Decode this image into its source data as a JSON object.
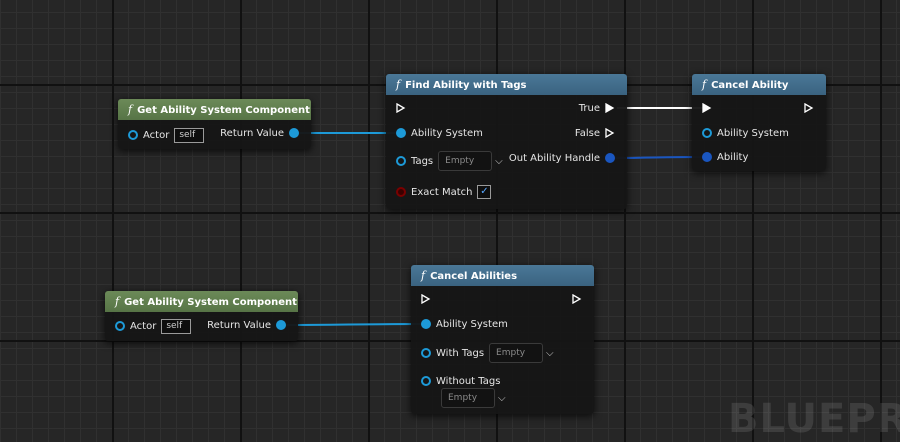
{
  "nodes": {
    "get_asc_1": {
      "title": "Get Ability System Component",
      "actor_label": "Actor",
      "actor_value": "self",
      "return_label": "Return Value"
    },
    "find_ability": {
      "title": "Find Ability with Tags",
      "true_label": "True",
      "false_label": "False",
      "ability_system_label": "Ability System",
      "tags_label": "Tags",
      "tags_value": "Empty",
      "out_handle_label": "Out Ability Handle",
      "exact_match_label": "Exact Match",
      "exact_match_checked": true
    },
    "cancel_ability": {
      "title": "Cancel Ability",
      "ability_system_label": "Ability System",
      "ability_label": "Ability"
    },
    "get_asc_2": {
      "title": "Get Ability System Component",
      "actor_label": "Actor",
      "actor_value": "self",
      "return_label": "Return Value"
    },
    "cancel_abilities": {
      "title": "Cancel Abilities",
      "ability_system_label": "Ability System",
      "with_tags_label": "With Tags",
      "with_tags_value": "Empty",
      "without_tags_label": "Without Tags",
      "without_tags_value": "Empty"
    }
  },
  "function_glyph": "f",
  "check_glyph": "✓",
  "chevron_glyph": "⌵",
  "watermark": "BLUEPRI",
  "icons": [
    "function-icon",
    "exec-pin-icon",
    "data-pin-icon",
    "checkbox-check-icon",
    "chevron-down-icon"
  ],
  "colors": {
    "pure_node_header": "#577446",
    "function_node_header": "#3a6380",
    "object_pin": "#1d9ad8",
    "struct_pin": "#1a56c0",
    "bool_pin": "#7a0000",
    "exec_wire": "#ffffff"
  }
}
